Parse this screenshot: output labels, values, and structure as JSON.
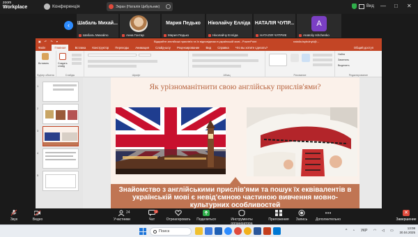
{
  "zoom": {
    "logo_line1": "zoom",
    "logo_line2": "Workplace",
    "conference_label": "Конференція",
    "tab_title": "Экран (Наталія Цибульник)",
    "view_label": "Вид",
    "minimize": "—",
    "maximize": "□",
    "close": "✕"
  },
  "participants": [
    {
      "big": "Шабаль Михай...",
      "small": "Шабаль Михайло"
    },
    {
      "big": "",
      "small": "Анна Гонтар"
    },
    {
      "big": "Мария Педько",
      "small": "Мария Педько"
    },
    {
      "big": "Ніколайчу Елліда",
      "small": "Ніколайчу Елліда"
    },
    {
      "big": "НАТАЛІЯ ЧУПР...",
      "small": "НАТАЛІЯ ЧУПРИК"
    },
    {
      "big": "A",
      "small": "Anatoliy Ishchenko"
    }
  ],
  "ppt": {
    "title": "Відкрийте англійські прислів'я та їх відповідники в українській мові - PowerPoint",
    "user": "natalia.tsybulnyk@...",
    "tabs": [
      "Файл",
      "Главная",
      "Вставка",
      "Конструктор",
      "Переходы",
      "Анимация",
      "Слайд-шоу",
      "Рецензирование",
      "Вид",
      "Справка",
      "Что вы хотите сделать?"
    ],
    "active_tab": "Главная",
    "share": "Общий доступ",
    "groups": [
      "Буфер обмена",
      "Слайды",
      "Шрифт",
      "Абзац",
      "Рисование",
      "Редактирование"
    ],
    "buttons": {
      "paste": "Вставить",
      "new_slide": "Создать слайд",
      "find": "Найти",
      "replace": "Заменить",
      "select": "Выделить"
    },
    "thumb_numbers": [
      "1",
      "2",
      "3",
      "4",
      "5"
    ]
  },
  "slide": {
    "title": "Як урізноманітнити свою англійську прислів'ями?",
    "banner": "Знайомство з англійськими прислів'ями та пошук їх еквівалентів в українській мові є невід'ємною частиною вивчення мовно-культурних особливостей"
  },
  "toolbar": {
    "audio": "Звук",
    "video": "Видео",
    "participants": "Участники",
    "participants_count": "24",
    "chat": "Чат",
    "chat_badge": "1",
    "reactions": "Отреагировать",
    "share": "Поделиться",
    "organizer_tools": "Инструменты организатора",
    "apps": "Приложения",
    "record": "Запись",
    "more": "Дополнительно",
    "end": "Завершение"
  },
  "taskbar": {
    "search_placeholder": "Поиск",
    "language": "УКР",
    "time": "13:08",
    "date": "30.04.2025"
  },
  "colors": {
    "ppt_accent": "#c34525",
    "zoom_blue": "#2d8cff",
    "slide_banner": "#c07553",
    "title_color": "#b7633e"
  }
}
